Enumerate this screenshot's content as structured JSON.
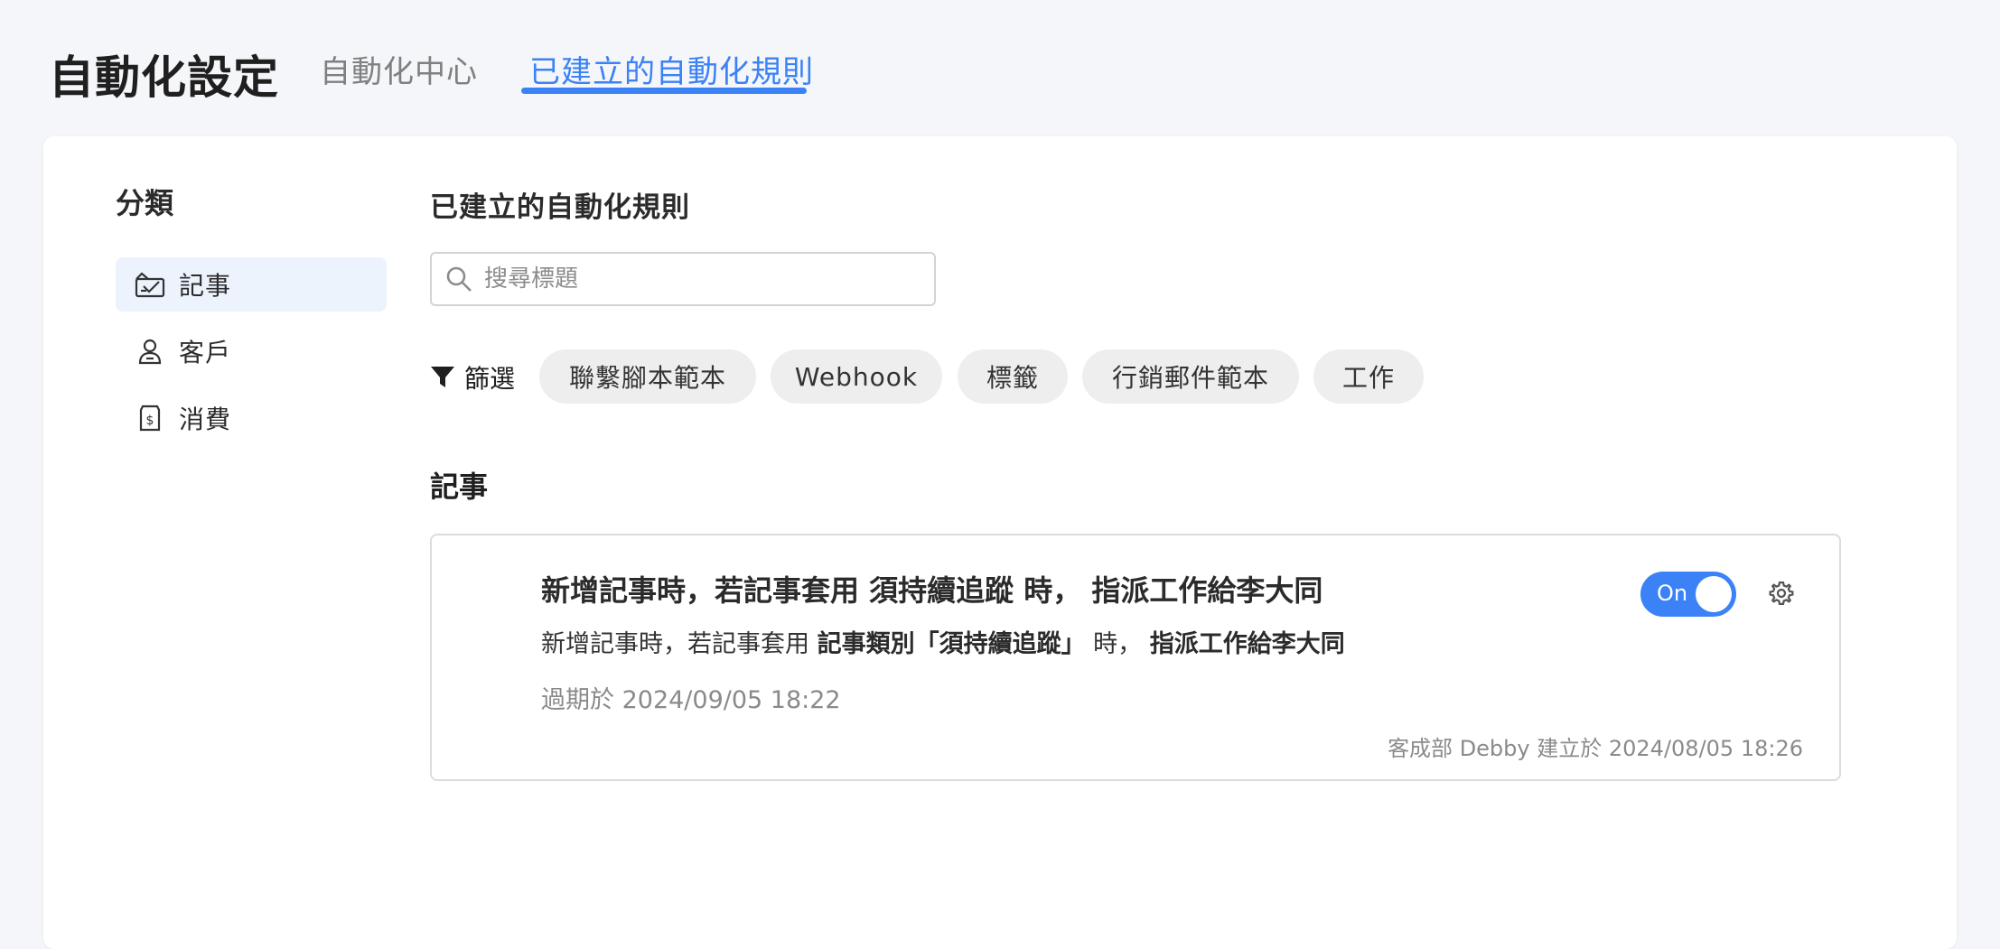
{
  "header": {
    "title": "自動化設定",
    "tabs": [
      {
        "label": "自動化中心"
      },
      {
        "label": "已建立的自動化規則"
      }
    ]
  },
  "sidebar": {
    "title": "分類",
    "items": [
      {
        "label": "記事",
        "icon": "note-icon",
        "active": true
      },
      {
        "label": "客戶",
        "icon": "user-icon"
      },
      {
        "label": "消費",
        "icon": "receipt-icon"
      }
    ]
  },
  "main": {
    "title": "已建立的自動化規則",
    "search": {
      "placeholder": "搜尋標題",
      "value": ""
    },
    "filter": {
      "label": "篩選",
      "chips": [
        "聯繫腳本範本",
        "Webhook",
        "標籤",
        "行銷郵件範本",
        "工作"
      ]
    },
    "section_title": "記事",
    "rule": {
      "title": "新增記事時，若記事套用 須持續追蹤 時， 指派工作給李大同",
      "desc_prefix": "新增記事時，若記事套用 ",
      "desc_bold1": "記事類別「須持續追蹤」",
      "desc_mid": " 時， ",
      "desc_bold2": "指派工作給李大同",
      "expire": "過期於 2024/09/05 18:22",
      "creator": "客成部 Debby 建立於 2024/08/05 18:26",
      "toggle_label": "On"
    }
  },
  "colors": {
    "accent": "#3b82f6",
    "active_bg": "#ecf3fd",
    "chip_bg": "#eeeeee",
    "page_bg": "#f5f6fa"
  }
}
